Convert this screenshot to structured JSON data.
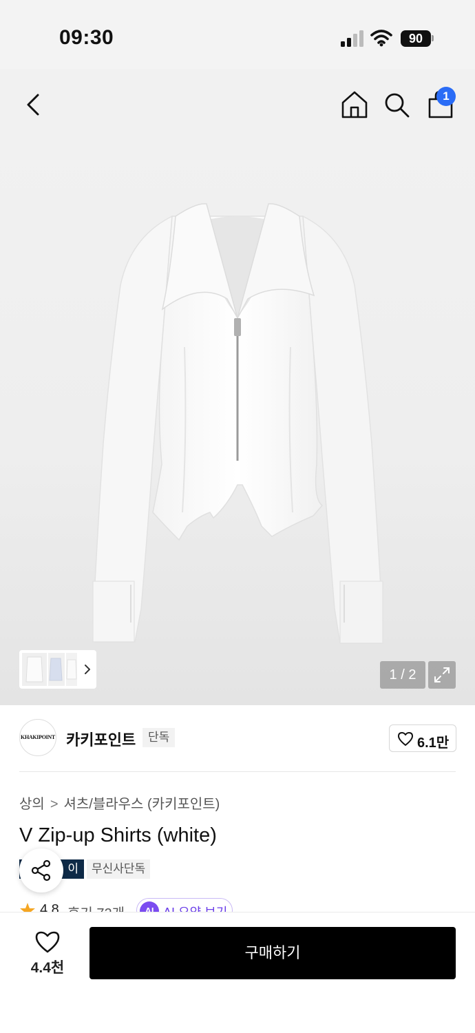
{
  "status_bar": {
    "time": "09:30",
    "battery": "90",
    "signal_icon": "cellular-signal-icon",
    "wifi_icon": "wifi-icon"
  },
  "nav": {
    "back_icon": "chevron-left-icon",
    "home_icon": "home-icon",
    "search_icon": "search-icon",
    "cart_icon": "shopping-bag-icon",
    "cart_badge": "1"
  },
  "gallery": {
    "counter": "1 / 2",
    "expand_icon": "expand-icon",
    "thumbnail_arrow": "›"
  },
  "brand": {
    "logo_text": "KHAKIPOINT",
    "name": "카키포인트",
    "tag": "단독",
    "like_count": "6.1만"
  },
  "product": {
    "breadcrumb": [
      "상의",
      "셔츠/블라우스 (카키포인트)"
    ],
    "breadcrumb_separator": ">",
    "title": "V Zip-up Shirts (white)",
    "tags": [
      "이",
      "무신사단독"
    ],
    "rating": "4.8",
    "review_label": "후기 72개",
    "ai_icon": "AI",
    "ai_label": "AI 요약 보기"
  },
  "bottom_bar": {
    "like_count": "4.4천",
    "buy_label": "구매하기"
  },
  "colors": {
    "accent_blue": "#2a6cf6",
    "tag_dark": "#0e2a47",
    "ai_purple": "#7b4cf0",
    "star": "#f5a623",
    "buy_button": "#000000"
  }
}
